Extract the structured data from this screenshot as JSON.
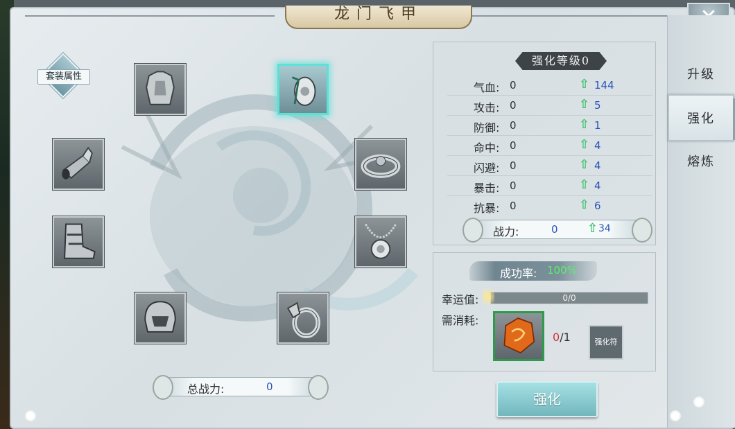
{
  "window": {
    "title": "龙门飞甲",
    "close_icon": "close-icon"
  },
  "set_attributes": {
    "label": "套装属性"
  },
  "equipment_slots": [
    {
      "name": "armor",
      "icon": "armor-icon"
    },
    {
      "name": "pendant",
      "icon": "pendant-icon",
      "selected": true
    },
    {
      "name": "bracer",
      "icon": "bracer-icon"
    },
    {
      "name": "bracelet",
      "icon": "bracelet-icon"
    },
    {
      "name": "boots",
      "icon": "boots-icon"
    },
    {
      "name": "necklace",
      "icon": "necklace-icon"
    },
    {
      "name": "helmet",
      "icon": "helmet-icon"
    },
    {
      "name": "ring",
      "icon": "ring-icon"
    }
  ],
  "total_power": {
    "label": "总战力:",
    "value": "0"
  },
  "stats": {
    "level_label": "强化等级0",
    "rows": [
      {
        "name": "气血:",
        "value": "0",
        "increase": "144"
      },
      {
        "name": "攻击:",
        "value": "0",
        "increase": "5"
      },
      {
        "name": "防御:",
        "value": "0",
        "increase": "1"
      },
      {
        "name": "命中:",
        "value": "0",
        "increase": "4"
      },
      {
        "name": "闪避:",
        "value": "0",
        "increase": "4"
      },
      {
        "name": "暴击:",
        "value": "0",
        "increase": "4"
      },
      {
        "name": "抗暴:",
        "value": "0",
        "increase": "6"
      }
    ],
    "power": {
      "label": "战力:",
      "value": "0",
      "increase": "34"
    }
  },
  "success": {
    "rate_label": "成功率:",
    "rate_value": "100%",
    "luck_label": "幸运值:",
    "luck_value": "0/0",
    "need_label": "需消耗:",
    "need_have": "0",
    "need_total": "/1",
    "charm_button": "强化符",
    "stone_icon": "strengthen-stone-icon"
  },
  "strengthen_button": "强化",
  "side_tabs": [
    {
      "label": "升级"
    },
    {
      "label": "强化",
      "active": true
    },
    {
      "label": "熔炼"
    }
  ],
  "colors": {
    "accent_teal": "#72b7bd",
    "success_green": "#5bf06a",
    "increase_blue": "#2a54b8",
    "arrow_green": "#3ec26d",
    "shortage_red": "#d0303a"
  }
}
